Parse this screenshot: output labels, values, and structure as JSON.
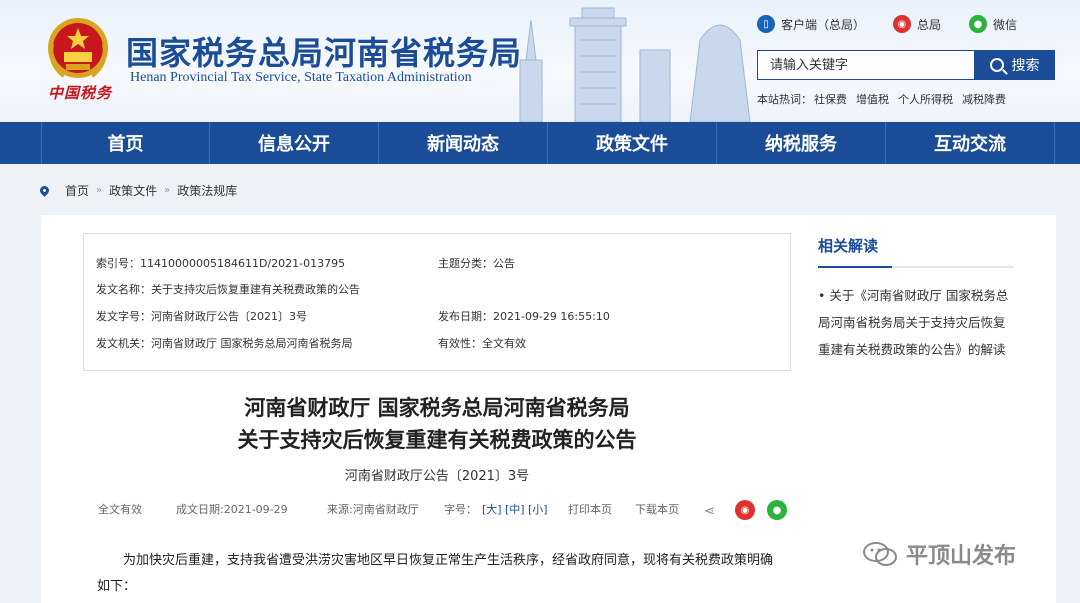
{
  "header": {
    "site_title": "国家税务总局河南省税务局",
    "site_subtitle": "Henan Provincial Tax Service, State Taxation Administration",
    "seal_text": "中国税务",
    "links": [
      {
        "label": "客户端（总局）",
        "icon": "mobile-client-icon"
      },
      {
        "label": "总局",
        "icon": "weibo-icon"
      },
      {
        "label": "微信",
        "icon": "wechat-icon"
      }
    ],
    "search": {
      "placeholder": "请输入关键字",
      "button": "搜索"
    },
    "hot": {
      "label": "本站热词：",
      "words": [
        "社保费",
        "增值税",
        "个人所得税",
        "减税降费"
      ]
    }
  },
  "nav": [
    "首页",
    "信息公开",
    "新闻动态",
    "政策文件",
    "纳税服务",
    "互动交流"
  ],
  "breadcrumb": [
    "首页",
    "政策文件",
    "政策法规库"
  ],
  "meta": {
    "index_no": "索引号：11410000005184611D/2021-013795",
    "topic": "主题分类：公告",
    "doc_name": "发文名称：关于支持灾后恢复重建有关税费政策的公告",
    "doc_code": "发文字号：河南省财政厅公告〔2021〕3号",
    "publish_date": "发布日期：2021-09-29 16:55:10",
    "issuer": "发文机关：河南省财政厅 国家税务总局河南省税务局",
    "validity": "有效性：全文有效"
  },
  "related": {
    "title": "相关解读",
    "items": [
      "• 关于《河南省财政厅 国家税务总局河南省税务局关于支持灾后恢复重建有关税费政策的公告》的解读"
    ]
  },
  "document": {
    "title_line1": "河南省财政厅 国家税务总局河南省税务局",
    "title_line2": "关于支持灾后恢复重建有关税费政策的公告",
    "number": "河南省财政厅公告〔2021〕3号",
    "tools": {
      "validity": "全文有效",
      "date": "成文日期:2021-09-29",
      "source": "来源:河南省财政厅",
      "font_label": "字号：",
      "font_large": "[大]",
      "font_medium": "[中]",
      "font_small": "[小]",
      "print": "打印本页",
      "download": "下载本页"
    },
    "body": "为加快灾后重建，支持我省遭受洪涝灾害地区早日恢复正常生产生活秩序，经省政府同意，现将有关税费政策明确如下："
  },
  "watermark": "平顶山发布",
  "colors": {
    "brand": "#1a4c97",
    "weibo": "#e0312f",
    "wechat": "#2bb33f"
  }
}
